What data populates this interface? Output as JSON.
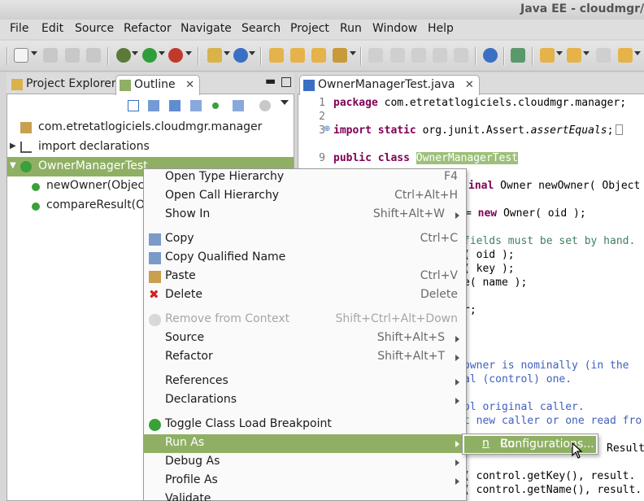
{
  "window": {
    "title": "Java EE - cloudmgr/t"
  },
  "menubar": [
    "File",
    "Edit",
    "Source",
    "Refactor",
    "Navigate",
    "Search",
    "Project",
    "Run",
    "Window",
    "Help"
  ],
  "left_panel": {
    "tabs": [
      {
        "label": "Project Explorer",
        "active": false
      },
      {
        "label": "Outline",
        "active": true
      }
    ],
    "tree": [
      {
        "label": "com.etretatlogiciels.cloudmgr.manager",
        "icon": "package-icon"
      },
      {
        "label": "import declarations",
        "icon": "imports-icon"
      },
      {
        "label": "OwnerManagerTest",
        "icon": "class-icon",
        "selected": true
      },
      {
        "label": "newOwner(ObjectI",
        "icon": "static-method-icon"
      },
      {
        "label": "compareResult(Ow",
        "icon": "static-method-icon"
      }
    ]
  },
  "editor": {
    "tab_label": "OwnerManagerTest.java",
    "line_numbers": [
      "1",
      "2",
      "3",
      "9"
    ],
    "lines": {
      "l1_kw": "package",
      "l1_rest": " com.etretatlogiciels.cloudmgr.manager;",
      "l3_kw": "import static",
      "l3_rest": " org.junit.Assert.",
      "l3_method": "assertEquals",
      "l3_end": ";",
      "l9_kw": "public class",
      "l9_name": "OwnerManagerTest",
      "f1_kw": "inal",
      "f1_rest": " Owner newOwner( Object",
      "f2_eq": "= ",
      "f2_kw": "new",
      "f2_rest": " Owner( oid );",
      "f3": " fields must be set by hand.",
      "f4": "( oid );",
      "f5": "( key );",
      "f6": "e( name );",
      "f7": "r;",
      "f8": " owner is nominally (in the",
      "f9": "al (control) one.",
      "f10": "ol original caller.",
      "f11": "t new caller or one read fro",
      "f12": "Result",
      "f13": "( control.getKey(),  result.",
      "f14": "( control.getName(), result."
    }
  },
  "context_menu": {
    "items": [
      {
        "label": "Open Type Hierarchy",
        "shortcut": "F4"
      },
      {
        "label": "Open Call Hierarchy",
        "shortcut": "Ctrl+Alt+H"
      },
      {
        "label": "Show In",
        "shortcut": "Shift+Alt+W"
      },
      {
        "label": "Copy",
        "shortcut": "Ctrl+C"
      },
      {
        "label": "Copy Qualified Name",
        "shortcut": ""
      },
      {
        "label": "Paste",
        "shortcut": "Ctrl+V"
      },
      {
        "label": "Delete",
        "shortcut": "Delete"
      },
      {
        "label": "Remove from Context",
        "shortcut": "Shift+Ctrl+Alt+Down"
      },
      {
        "label": "Source",
        "shortcut": "Shift+Alt+S"
      },
      {
        "label": "Refactor",
        "shortcut": "Shift+Alt+T"
      },
      {
        "label": "References",
        "shortcut": ""
      },
      {
        "label": "Declarations",
        "shortcut": ""
      },
      {
        "label": "Toggle Class Load Breakpoint",
        "shortcut": ""
      },
      {
        "label": "Run As",
        "shortcut": ""
      },
      {
        "label": "Debug As",
        "shortcut": ""
      },
      {
        "label": "Profile As",
        "shortcut": ""
      },
      {
        "label": "Validate",
        "shortcut": ""
      }
    ]
  },
  "submenu": {
    "label_pre": "Ru",
    "label_u": "n",
    "label_post": " Configurations..."
  },
  "colors": {
    "selection": "#8fb064",
    "keyword": "#7f0055",
    "comment": "#3f7f5f",
    "javadoc": "#3f5fbf"
  }
}
